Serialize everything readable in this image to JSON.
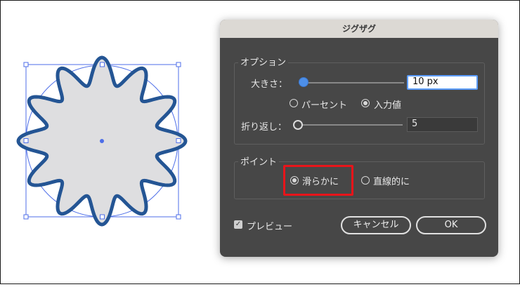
{
  "dialog": {
    "title": "ジグザグ",
    "options_group_title": "オプション",
    "size_label": "大きさ：",
    "size_value": "10 px",
    "size_slider_fraction": 0.04,
    "mode_percent_label": "パーセント",
    "mode_absolute_label": "入力値",
    "mode_selected": "absolute",
    "ridges_label": "折り返し：",
    "ridges_value": "5",
    "ridges_slider_fraction": 0.0,
    "point_group_title": "ポイント",
    "smooth_label": "滑らかに",
    "corner_label": "直線的に",
    "point_selected": "smooth",
    "preview_label": "プレビュー",
    "preview_checked": true,
    "cancel_label": "キャンセル",
    "ok_label": "OK"
  },
  "colors": {
    "shape_stroke": "#245594",
    "shape_fill": "#dedee0",
    "selection": "#4d6ee8",
    "highlight_box": "#e8141a",
    "slider_thumb": "#4d8fe8"
  }
}
